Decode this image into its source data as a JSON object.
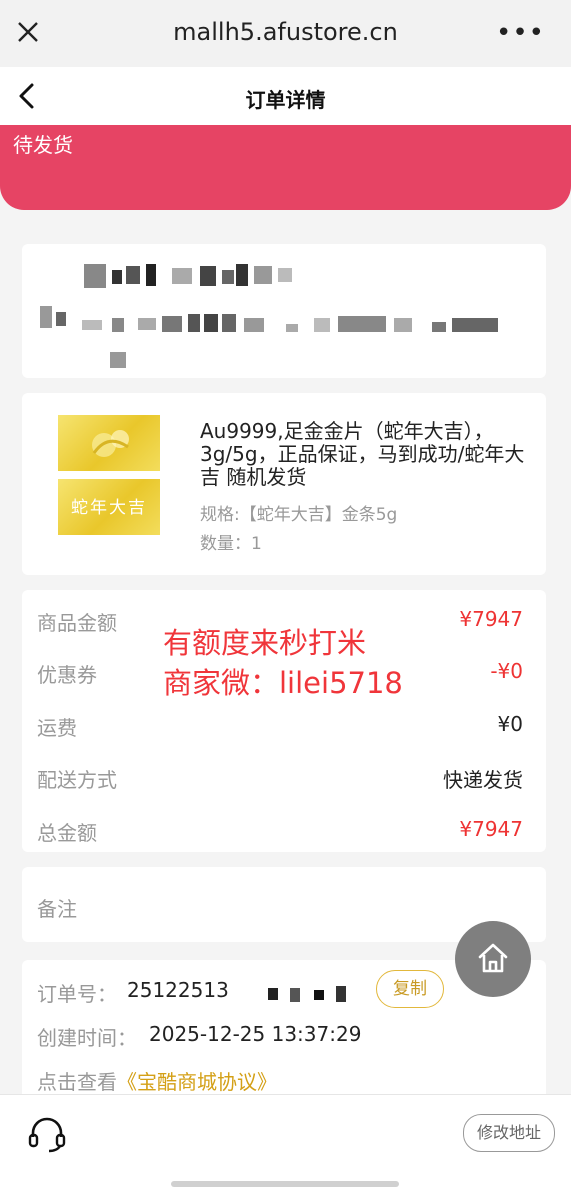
{
  "browser": {
    "url": "mallh5.afustore.cn",
    "more": "•••"
  },
  "nav": {
    "title": "订单详情"
  },
  "status": {
    "text": "待发货"
  },
  "product": {
    "title": "Au9999,足金金片（蛇年大吉），3g/5g，正品保证，马到成功/蛇年大吉 随机发货",
    "image_label": "蛇年大吉",
    "spec": "规格:【蛇年大吉】金条5g",
    "quantity": "数量：1"
  },
  "pricing": {
    "rows": [
      {
        "label": "商品金额",
        "value": "¥7947"
      },
      {
        "label": "优惠券",
        "value": "-¥0"
      },
      {
        "label": "运费",
        "value": "¥0"
      },
      {
        "label": "配送方式",
        "value": "快递发货"
      },
      {
        "label": "总金额",
        "value": "¥7947"
      }
    ],
    "overlay_line1": "有额度来秒打米",
    "overlay_line2": "商家微：lilei5718"
  },
  "remark": {
    "label": "备注"
  },
  "order": {
    "number_label": "订单号：",
    "number_value": "25122513",
    "copy_label": "复制",
    "created_label": "创建时间：",
    "created_value": "2025-12-25 13:37:29",
    "agreement_prefix": "点击查看",
    "agreement_link": "《宝酷商城协议》"
  },
  "bottom": {
    "edit_address": "修改地址"
  },
  "colors": {
    "status_banner": "#e64464",
    "price_red": "#e33333",
    "overlay_red": "#f0353a",
    "copy_gold": "#c89a23"
  },
  "icons": [
    "close-icon",
    "more-icon",
    "back-chevron-icon",
    "home-icon",
    "customer-service-icon"
  ]
}
